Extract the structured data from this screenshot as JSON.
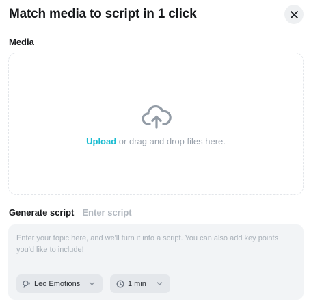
{
  "dialog": {
    "title": "Match media to script in 1 click",
    "close_icon": "close-icon"
  },
  "media": {
    "label": "Media",
    "upload_icon": "cloud-upload-icon",
    "upload_link": "Upload",
    "drop_text": " or drag and drop files here."
  },
  "script": {
    "tabs": [
      {
        "label": "Generate script",
        "active": true
      },
      {
        "label": "Enter script",
        "active": false
      }
    ],
    "placeholder": "Enter your topic here, and we'll turn it into a script. You can also add key points you'd like to include!",
    "voice_select": {
      "value": "Leo Emotions",
      "icon": "voice-icon"
    },
    "duration_select": {
      "value": "1 min",
      "icon": "clock-icon"
    }
  },
  "colors": {
    "accent": "#19bcd1",
    "box_bg": "#f2f4f6",
    "muted_text": "#9aa2ac"
  }
}
